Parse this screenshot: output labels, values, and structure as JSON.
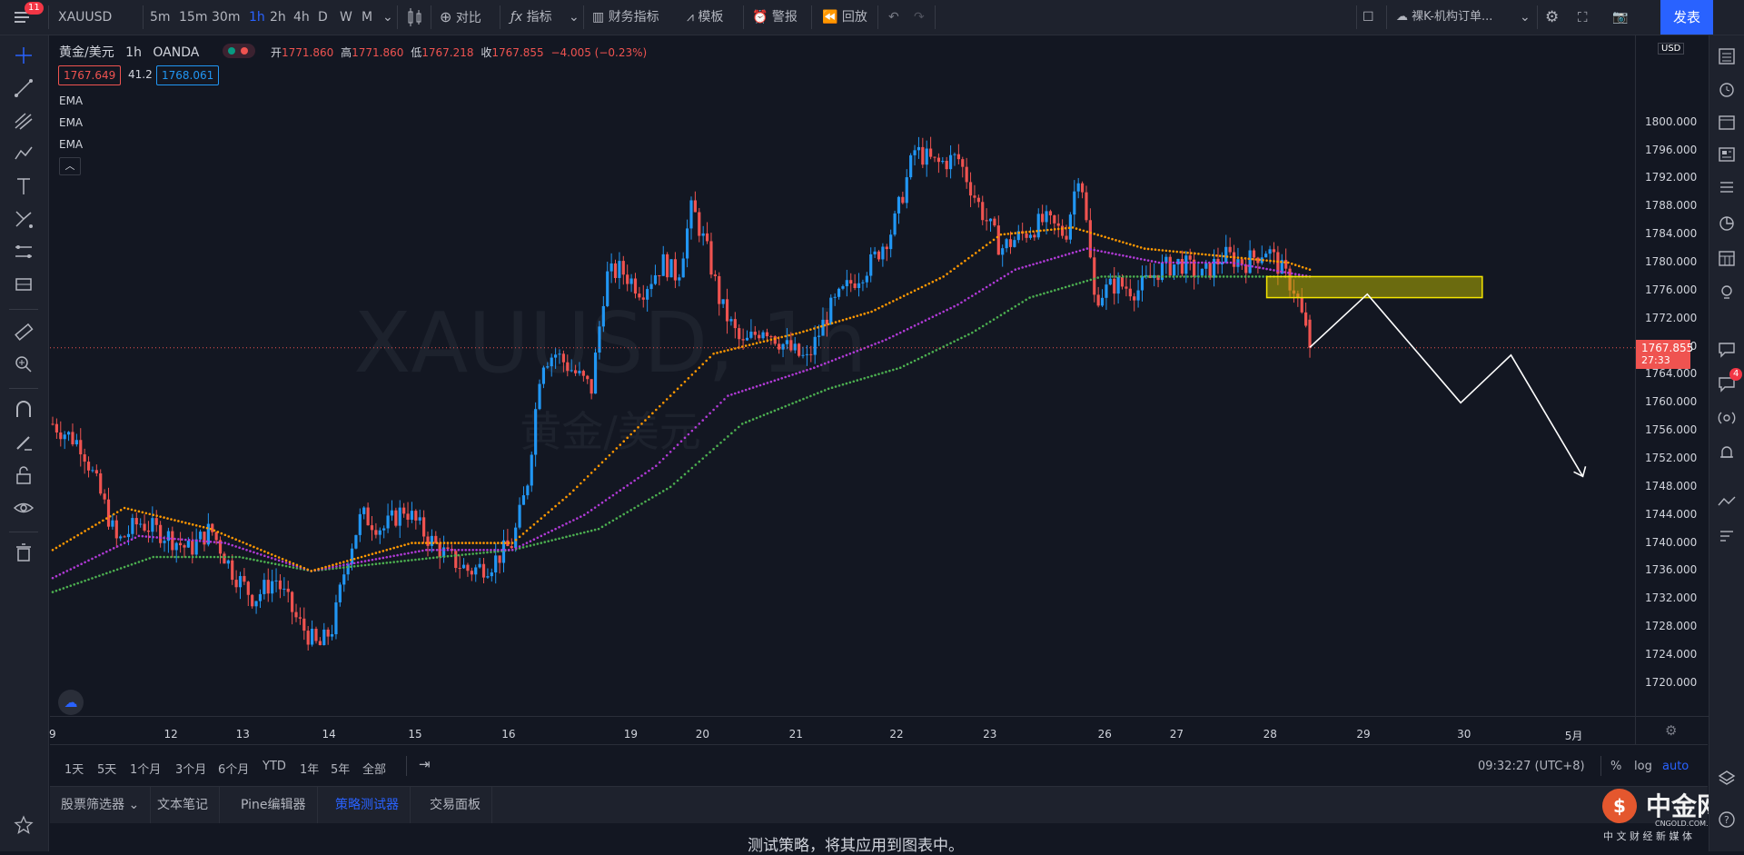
{
  "topbar": {
    "notif_count": "11",
    "symbol": "XAUUSD",
    "intervals": [
      "5m",
      "15m",
      "30m",
      "1h",
      "2h",
      "4h",
      "D",
      "W",
      "M"
    ],
    "active_interval": "1h",
    "compare_label": "对比",
    "indicators_label": "指标",
    "financials_label": "财务指标",
    "templates_label": "模板",
    "alert_label": "警报",
    "replay_label": "回放",
    "layout_name": "裸K-机构订单...",
    "publish_label": "发表"
  },
  "legend": {
    "title": "黄金/美元",
    "interval": "1h",
    "source": "OANDA",
    "open_label": "开",
    "open": "1771.860",
    "high_label": "高",
    "high": "1771.860",
    "low_label": "低",
    "low": "1767.218",
    "close_label": "收",
    "close": "1767.855",
    "change": "−4.005 (−0.23%)",
    "bid": "1767.649",
    "spread": "41.2",
    "ask": "1768.061",
    "studies": [
      "EMA",
      "EMA",
      "EMA"
    ]
  },
  "watermark": {
    "symbol": "XAUUSD, 1h",
    "name": "黄金/美元"
  },
  "price_axis": {
    "currency": "USD",
    "last_price": "1767.855",
    "countdown": "27:33"
  },
  "time_axis_labels": [
    "9",
    "12",
    "13",
    "14",
    "15",
    "16",
    "19",
    "20",
    "21",
    "22",
    "23",
    "26",
    "27",
    "28",
    "29",
    "30",
    "5月"
  ],
  "range_bar": {
    "ranges": [
      "1天",
      "5天",
      "1个月",
      "3个月",
      "6个月",
      "YTD",
      "1年",
      "5年",
      "全部"
    ],
    "time": "09:32:27 (UTC+8)",
    "percent": "%",
    "log": "log",
    "auto": "auto"
  },
  "bottom_tabs": [
    "股票筛选器",
    "文本笔记",
    "Pine编辑器",
    "策略测试器",
    "交易面板"
  ],
  "active_tab": "策略测试器",
  "bottom_panel": {
    "message": "测试策略，将其应用到图表中。"
  },
  "brand": {
    "name": "中金网",
    "url": "CNGOLD.COM.CN",
    "slogan": "中 文 财 经 新 媒 体"
  },
  "notifications": {
    "chat_badge": "4"
  },
  "colors": {
    "up": "#2196f3",
    "down": "#ef5350",
    "ema_fast": "#ff9800",
    "ema_mid": "#b03ad6",
    "ema_slow": "#4caf50",
    "accent": "#2962ff",
    "zone": "#b5b000"
  },
  "chart_data": {
    "type": "candlestick",
    "symbol": "XAUUSD",
    "interval": "1h",
    "y_range": [
      1717,
      1808
    ],
    "y_ticks": [
      1720,
      1724,
      1728,
      1732,
      1736,
      1740,
      1744,
      1748,
      1752,
      1756,
      1760,
      1764,
      1768,
      1772,
      1776,
      1780,
      1784,
      1788,
      1792,
      1796,
      1800
    ],
    "close_path": [
      {
        "t": 0,
        "v": 1757
      },
      {
        "t": 4,
        "v": 1754
      },
      {
        "t": 7,
        "v": 1746
      },
      {
        "t": 9,
        "v": 1740
      },
      {
        "t": 12,
        "v": 1743
      },
      {
        "t": 16,
        "v": 1741
      },
      {
        "t": 19,
        "v": 1739
      },
      {
        "t": 22,
        "v": 1742
      },
      {
        "t": 25,
        "v": 1736
      },
      {
        "t": 28,
        "v": 1732
      },
      {
        "t": 31,
        "v": 1735
      },
      {
        "t": 34,
        "v": 1729
      },
      {
        "t": 37,
        "v": 1725
      },
      {
        "t": 39,
        "v": 1728
      },
      {
        "t": 41,
        "v": 1738
      },
      {
        "t": 43,
        "v": 1744
      },
      {
        "t": 46,
        "v": 1742
      },
      {
        "t": 49,
        "v": 1745
      },
      {
        "t": 52,
        "v": 1741
      },
      {
        "t": 55,
        "v": 1738
      },
      {
        "t": 58,
        "v": 1736
      },
      {
        "t": 61,
        "v": 1737
      },
      {
        "t": 64,
        "v": 1740
      },
      {
        "t": 66,
        "v": 1748
      },
      {
        "t": 68,
        "v": 1766
      },
      {
        "t": 70,
        "v": 1767
      },
      {
        "t": 73,
        "v": 1764
      },
      {
        "t": 75,
        "v": 1762
      },
      {
        "t": 77,
        "v": 1778
      },
      {
        "t": 79,
        "v": 1779
      },
      {
        "t": 82,
        "v": 1776
      },
      {
        "t": 85,
        "v": 1780
      },
      {
        "t": 87,
        "v": 1778
      },
      {
        "t": 89,
        "v": 1788
      },
      {
        "t": 91,
        "v": 1782
      },
      {
        "t": 93,
        "v": 1774
      },
      {
        "t": 96,
        "v": 1768
      },
      {
        "t": 99,
        "v": 1771
      },
      {
        "t": 102,
        "v": 1768
      },
      {
        "t": 105,
        "v": 1766
      },
      {
        "t": 108,
        "v": 1773
      },
      {
        "t": 111,
        "v": 1777
      },
      {
        "t": 114,
        "v": 1780
      },
      {
        "t": 117,
        "v": 1785
      },
      {
        "t": 120,
        "v": 1796
      },
      {
        "t": 123,
        "v": 1794
      },
      {
        "t": 126,
        "v": 1795
      },
      {
        "t": 129,
        "v": 1788
      },
      {
        "t": 132,
        "v": 1782
      },
      {
        "t": 135,
        "v": 1784
      },
      {
        "t": 138,
        "v": 1786
      },
      {
        "t": 141,
        "v": 1784
      },
      {
        "t": 143,
        "v": 1794
      },
      {
        "t": 145,
        "v": 1775
      },
      {
        "t": 148,
        "v": 1777
      },
      {
        "t": 151,
        "v": 1776
      },
      {
        "t": 154,
        "v": 1779
      },
      {
        "t": 157,
        "v": 1780
      },
      {
        "t": 160,
        "v": 1778
      },
      {
        "t": 163,
        "v": 1781
      },
      {
        "t": 166,
        "v": 1780
      },
      {
        "t": 169,
        "v": 1782
      },
      {
        "t": 171,
        "v": 1779
      },
      {
        "t": 173,
        "v": 1776
      },
      {
        "t": 175,
        "v": 1767.855
      }
    ],
    "ema_fast": [
      {
        "t": 0,
        "v": 1739
      },
      {
        "t": 10,
        "v": 1745
      },
      {
        "t": 22,
        "v": 1742
      },
      {
        "t": 36,
        "v": 1736
      },
      {
        "t": 50,
        "v": 1740
      },
      {
        "t": 64,
        "v": 1740
      },
      {
        "t": 72,
        "v": 1747
      },
      {
        "t": 82,
        "v": 1757
      },
      {
        "t": 92,
        "v": 1767
      },
      {
        "t": 104,
        "v": 1770
      },
      {
        "t": 114,
        "v": 1773
      },
      {
        "t": 124,
        "v": 1778
      },
      {
        "t": 132,
        "v": 1784
      },
      {
        "t": 142,
        "v": 1785
      },
      {
        "t": 152,
        "v": 1782
      },
      {
        "t": 162,
        "v": 1781
      },
      {
        "t": 172,
        "v": 1780
      },
      {
        "t": 175,
        "v": 1779
      }
    ],
    "ema_mid": [
      {
        "t": 0,
        "v": 1735
      },
      {
        "t": 12,
        "v": 1741
      },
      {
        "t": 24,
        "v": 1740
      },
      {
        "t": 36,
        "v": 1736
      },
      {
        "t": 52,
        "v": 1739
      },
      {
        "t": 64,
        "v": 1739
      },
      {
        "t": 74,
        "v": 1744
      },
      {
        "t": 84,
        "v": 1751
      },
      {
        "t": 94,
        "v": 1761
      },
      {
        "t": 106,
        "v": 1765
      },
      {
        "t": 116,
        "v": 1769
      },
      {
        "t": 126,
        "v": 1774
      },
      {
        "t": 134,
        "v": 1779
      },
      {
        "t": 144,
        "v": 1782
      },
      {
        "t": 154,
        "v": 1780
      },
      {
        "t": 164,
        "v": 1780
      },
      {
        "t": 175,
        "v": 1778
      }
    ],
    "ema_slow": [
      {
        "t": 0,
        "v": 1733
      },
      {
        "t": 14,
        "v": 1738
      },
      {
        "t": 26,
        "v": 1738
      },
      {
        "t": 36,
        "v": 1736
      },
      {
        "t": 54,
        "v": 1738
      },
      {
        "t": 64,
        "v": 1739
      },
      {
        "t": 76,
        "v": 1742
      },
      {
        "t": 86,
        "v": 1748
      },
      {
        "t": 96,
        "v": 1757
      },
      {
        "t": 108,
        "v": 1762
      },
      {
        "t": 118,
        "v": 1765
      },
      {
        "t": 128,
        "v": 1770
      },
      {
        "t": 136,
        "v": 1775
      },
      {
        "t": 146,
        "v": 1778
      },
      {
        "t": 156,
        "v": 1778
      },
      {
        "t": 166,
        "v": 1778
      },
      {
        "t": 175,
        "v": 1778
      }
    ],
    "supply_zone": {
      "t_from": 169,
      "t_to": 199,
      "v_low": 1775,
      "v_high": 1778
    },
    "projection_path": [
      {
        "t": 175,
        "v": 1767.9
      },
      {
        "t": 183,
        "v": 1775.5
      },
      {
        "t": 196,
        "v": 1760
      },
      {
        "t": 203,
        "v": 1766.8
      },
      {
        "t": 213,
        "v": 1749.5
      }
    ]
  }
}
